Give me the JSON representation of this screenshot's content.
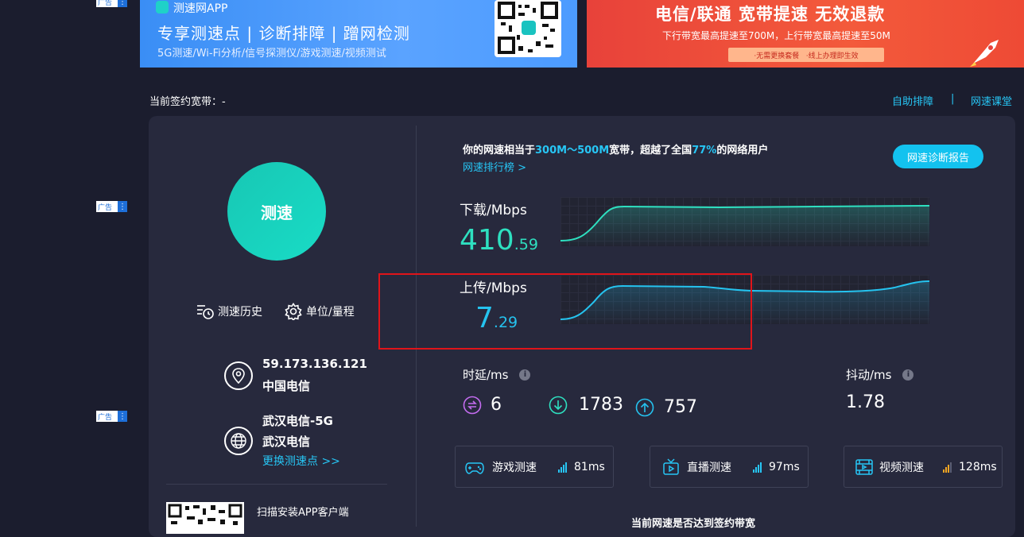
{
  "ads": {
    "tag": "广告",
    "more": "⋮"
  },
  "banner_app": {
    "app_name": "测速网APP",
    "headline": "专享测速点 | 诊断排障 | 蹭网检测",
    "sub": "5G测速/Wi-Fi分析/信号探测仪/游戏测速/视频测试"
  },
  "banner_isp": {
    "headline": "电信/联通 宽带提速 无效退款",
    "sub": "下行带宽最高提速至700M，上行带宽最高提速至50M",
    "tag1": "·无需更换套餐",
    "tag2": "·线上办理即生效"
  },
  "topbar": {
    "contract_label": "当前签约宽带：-",
    "self_check": "自助排障",
    "separator": "|",
    "class": "网速课堂"
  },
  "left": {
    "start_button": "测速",
    "history": "测速历史",
    "units": "单位/量程",
    "ip": "59.173.136.121",
    "ip_isp": "中国电信",
    "node": "武汉电信-5G",
    "node_isp": "武汉电信",
    "change_node": "更换测速点 >>",
    "app_qr_label": "扫描安装APP客户端"
  },
  "summary": {
    "prefix": "你的网速相当于",
    "range": "300M～500M",
    "middle": "宽带，超越了全国",
    "percent": "77%",
    "suffix": "的网络用户",
    "ranking_link": "网速排行榜 >",
    "report_button": "网速诊断报告"
  },
  "download": {
    "label": "下载/Mbps",
    "int": "410",
    "dec": ".59"
  },
  "upload": {
    "label": "上传/Mbps",
    "int": "7",
    "dec": ".29"
  },
  "latency": {
    "label": "时延/ms",
    "idle": "6",
    "down": "1783",
    "up": "757"
  },
  "jitter": {
    "label": "抖动/ms",
    "value": "1.78"
  },
  "tests": [
    {
      "name": "游戏测速",
      "value": "81ms"
    },
    {
      "name": "直播测速",
      "value": "97ms"
    },
    {
      "name": "视频测速",
      "value": "128ms"
    }
  ],
  "footer_question": "当前网速是否达到签约带宽",
  "colors": {
    "accent": "#27c6f5",
    "download": "#2ee0c0",
    "upload": "#25c3ef",
    "highlight_box": "#e0141a",
    "bg": "#1b1d2e",
    "card": "#27293d"
  }
}
